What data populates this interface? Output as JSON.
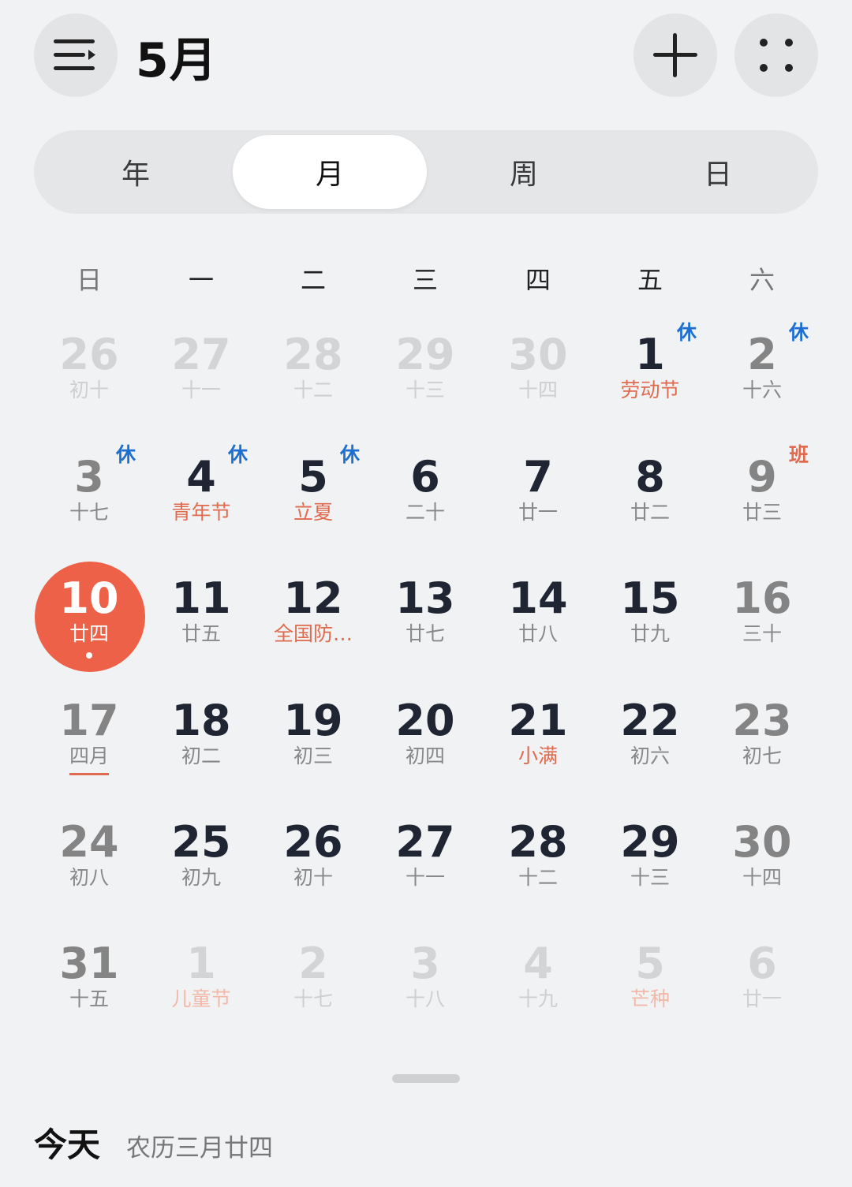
{
  "header": {
    "month_title": "5月",
    "menu_icon": "menu-icon",
    "add_icon": "plus-icon",
    "more_icon": "grid-dots-icon"
  },
  "view_tabs": [
    {
      "label": "年",
      "active": false
    },
    {
      "label": "月",
      "active": true
    },
    {
      "label": "周",
      "active": false
    },
    {
      "label": "日",
      "active": false
    }
  ],
  "weekdays": [
    "日",
    "一",
    "二",
    "三",
    "四",
    "五",
    "六"
  ],
  "weeks": [
    [
      {
        "day": "26",
        "lunar": "初十",
        "other": true
      },
      {
        "day": "27",
        "lunar": "十一",
        "other": true
      },
      {
        "day": "28",
        "lunar": "十二",
        "other": true
      },
      {
        "day": "29",
        "lunar": "十三",
        "other": true
      },
      {
        "day": "30",
        "lunar": "十四",
        "other": true
      },
      {
        "day": "1",
        "lunar": "劳动节",
        "red": true,
        "badge": "休"
      },
      {
        "day": "2",
        "lunar": "十六",
        "badge": "休"
      }
    ],
    [
      {
        "day": "3",
        "lunar": "十七",
        "badge": "休"
      },
      {
        "day": "4",
        "lunar": "青年节",
        "red": true,
        "badge": "休"
      },
      {
        "day": "5",
        "lunar": "立夏",
        "red": true,
        "badge": "休"
      },
      {
        "day": "6",
        "lunar": "二十"
      },
      {
        "day": "7",
        "lunar": "廿一"
      },
      {
        "day": "8",
        "lunar": "廿二"
      },
      {
        "day": "9",
        "lunar": "廿三",
        "badge": "班",
        "work": true
      }
    ],
    [
      {
        "day": "10",
        "lunar": "廿四",
        "today": true
      },
      {
        "day": "11",
        "lunar": "廿五"
      },
      {
        "day": "12",
        "lunar": "全国防…",
        "red": true
      },
      {
        "day": "13",
        "lunar": "廿七"
      },
      {
        "day": "14",
        "lunar": "廿八"
      },
      {
        "day": "15",
        "lunar": "廿九"
      },
      {
        "day": "16",
        "lunar": "三十"
      }
    ],
    [
      {
        "day": "17",
        "lunar": "四月",
        "underline": true
      },
      {
        "day": "18",
        "lunar": "初二"
      },
      {
        "day": "19",
        "lunar": "初三"
      },
      {
        "day": "20",
        "lunar": "初四"
      },
      {
        "day": "21",
        "lunar": "小满",
        "red": true
      },
      {
        "day": "22",
        "lunar": "初六"
      },
      {
        "day": "23",
        "lunar": "初七"
      }
    ],
    [
      {
        "day": "24",
        "lunar": "初八"
      },
      {
        "day": "25",
        "lunar": "初九"
      },
      {
        "day": "26",
        "lunar": "初十"
      },
      {
        "day": "27",
        "lunar": "十一"
      },
      {
        "day": "28",
        "lunar": "十二"
      },
      {
        "day": "29",
        "lunar": "十三"
      },
      {
        "day": "30",
        "lunar": "十四"
      }
    ],
    [
      {
        "day": "31",
        "lunar": "十五"
      },
      {
        "day": "1",
        "lunar": "儿童节",
        "red": true,
        "other": true
      },
      {
        "day": "2",
        "lunar": "十七",
        "other": true
      },
      {
        "day": "3",
        "lunar": "十八",
        "other": true
      },
      {
        "day": "4",
        "lunar": "十九",
        "other": true
      },
      {
        "day": "5",
        "lunar": "芒种",
        "red": true,
        "other": true
      },
      {
        "day": "6",
        "lunar": "廿一",
        "other": true
      }
    ]
  ],
  "footer": {
    "today_label": "今天",
    "lunar_date": "农历三月廿四"
  },
  "colors": {
    "accent": "#ee6149",
    "holiday_badge": "#1d6fd1",
    "background": "#f1f2f4"
  }
}
